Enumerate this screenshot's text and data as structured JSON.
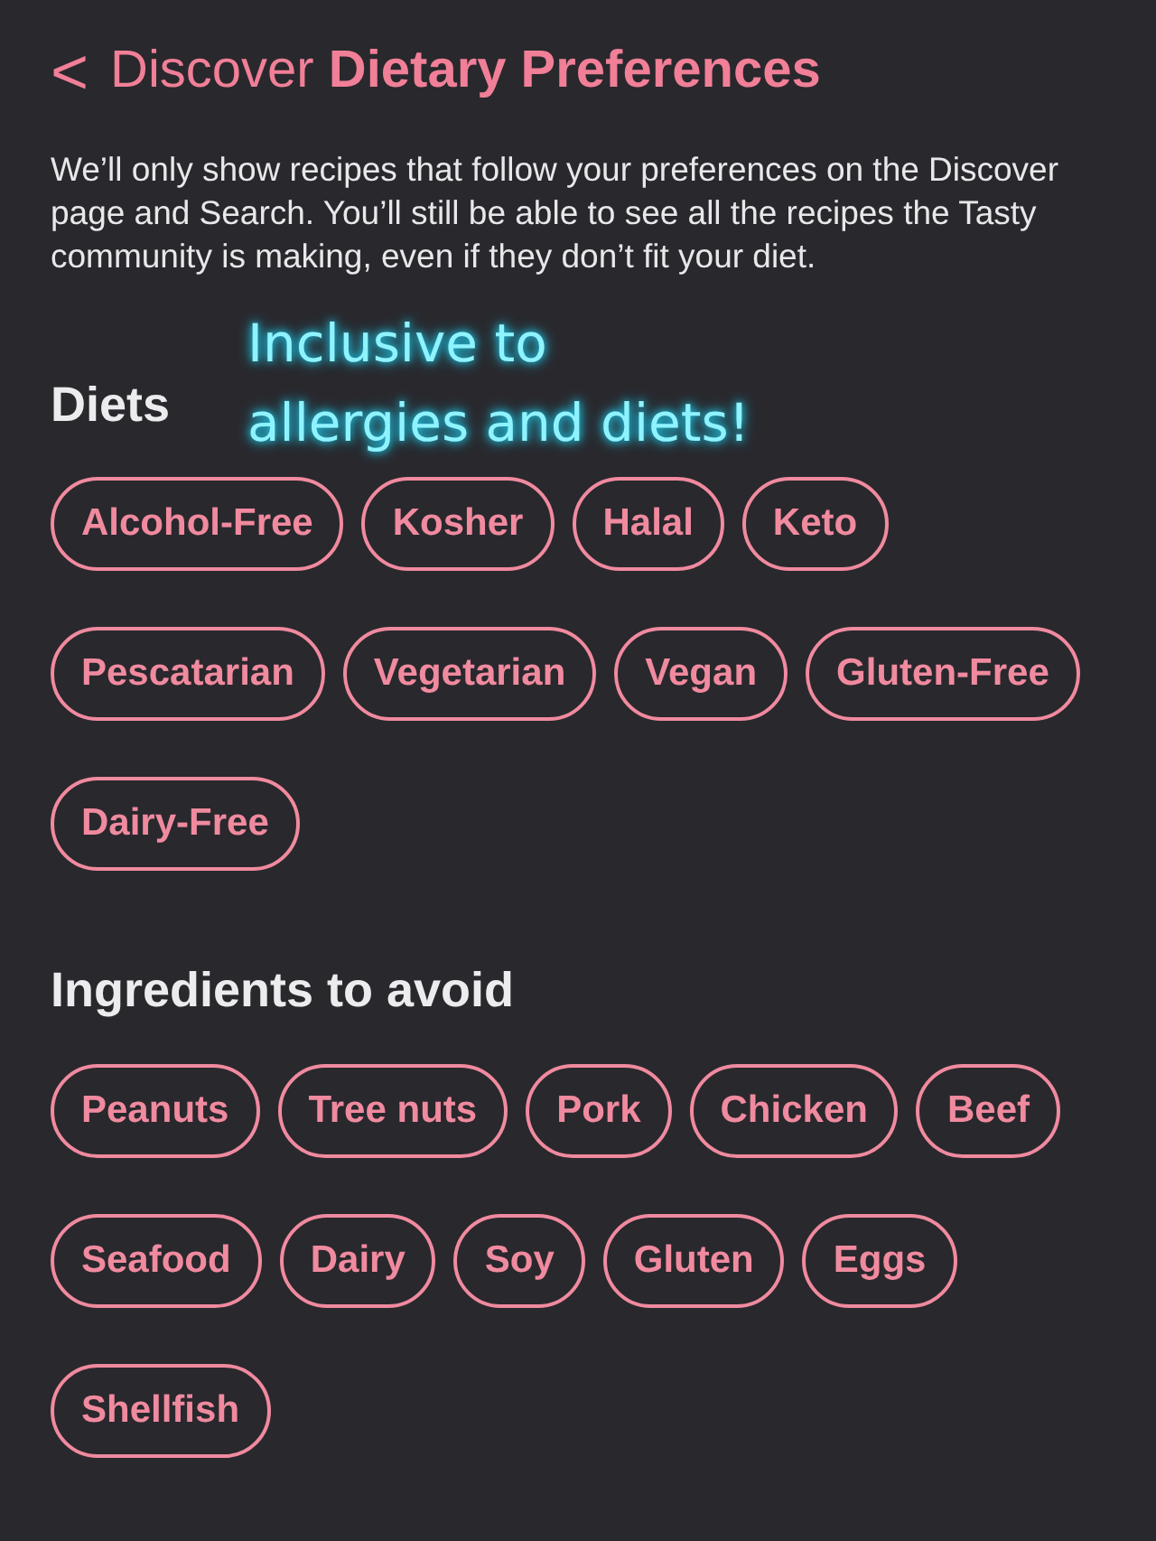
{
  "header": {
    "back": "<",
    "title_prefix": "Discover",
    "title": "Dietary Preferences"
  },
  "description": "We’ll only show recipes that follow your preferences on the Discover page and Search. You’ll still be able to see all the recipes the Tasty community is making, even if they don’t fit your diet.",
  "annotation": {
    "lines": [
      "Inclusive to",
      "allergies and diets!"
    ]
  },
  "sections": [
    {
      "title": "Diets",
      "chips": [
        {
          "label": "Alcohol-Free",
          "selected": false
        },
        {
          "label": "Kosher",
          "selected": false
        },
        {
          "label": "Halal",
          "selected": false
        },
        {
          "label": "Keto",
          "selected": false
        },
        {
          "label": "Pescatarian",
          "selected": false
        },
        {
          "label": "Vegetarian",
          "selected": false
        },
        {
          "label": "Vegan",
          "selected": false
        },
        {
          "label": "Gluten-Free",
          "selected": false
        },
        {
          "label": "Dairy-Free",
          "selected": false
        }
      ]
    },
    {
      "title": "Ingredients to avoid",
      "chips": [
        {
          "label": "Peanuts",
          "selected": false
        },
        {
          "label": "Tree nuts",
          "selected": false
        },
        {
          "label": "Pork",
          "selected": false
        },
        {
          "label": "Chicken",
          "selected": false
        },
        {
          "label": "Beef",
          "selected": false
        },
        {
          "label": "Seafood",
          "selected": false
        },
        {
          "label": "Dairy",
          "selected": false
        },
        {
          "label": "Soy",
          "selected": false
        },
        {
          "label": "Gluten",
          "selected": false
        },
        {
          "label": "Eggs",
          "selected": false
        },
        {
          "label": "Shellfish",
          "selected": false
        }
      ]
    }
  ]
}
